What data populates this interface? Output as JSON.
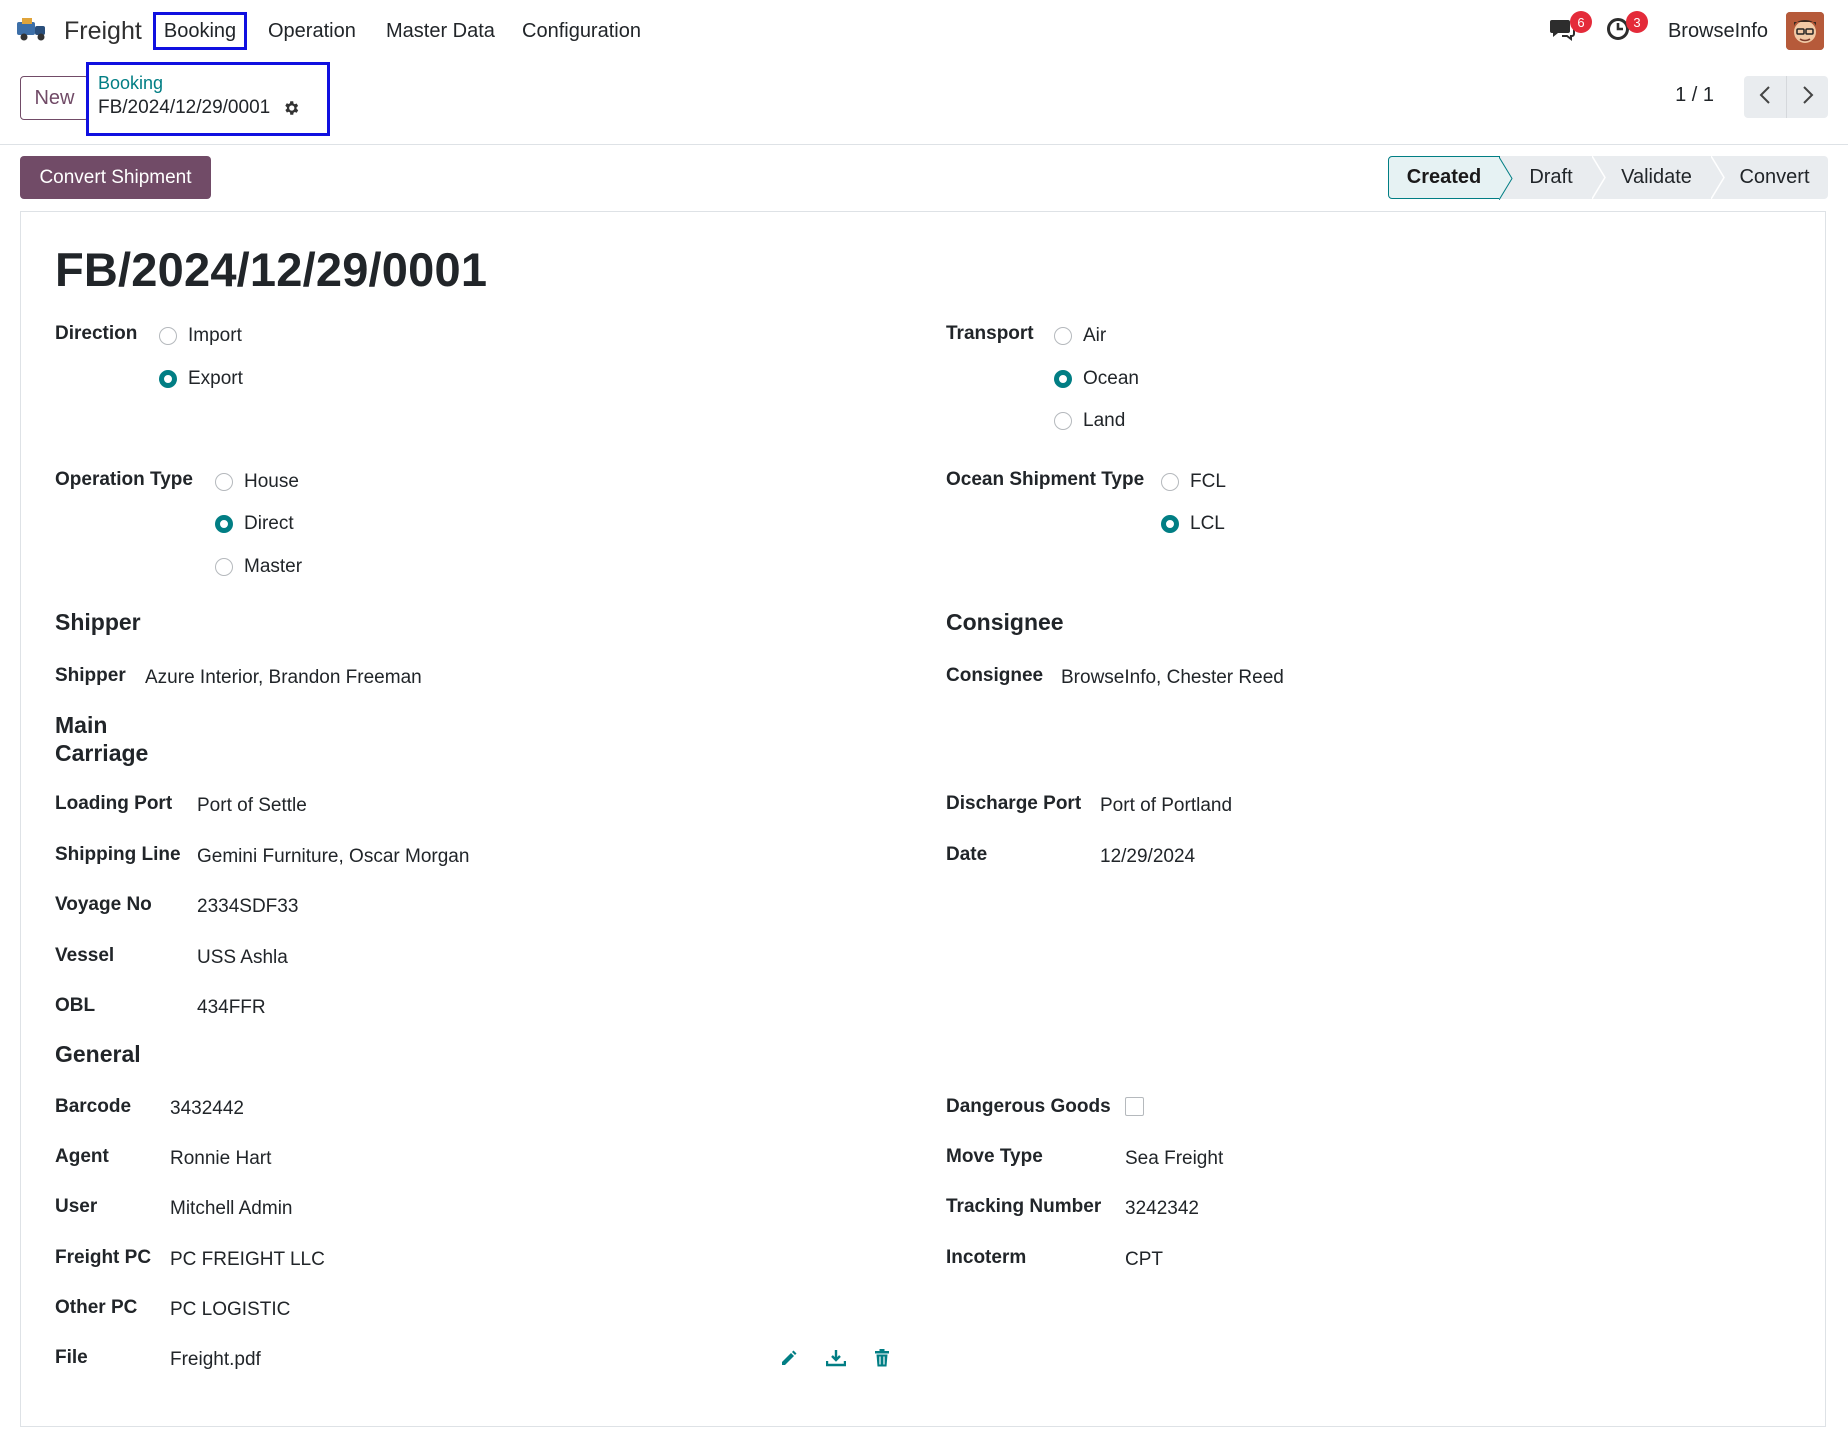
{
  "navbar": {
    "app_name": "Freight",
    "menus": [
      "Booking",
      "Operation",
      "Master Data",
      "Configuration"
    ],
    "messages_count": "6",
    "activities_count": "3",
    "company": "BrowseInfo",
    "icons": {
      "app": "truck-icon",
      "messages": "chat-icon",
      "activities": "clock-icon"
    }
  },
  "control_panel": {
    "new_label": "New",
    "breadcrumb_parent": "Booking",
    "breadcrumb_current": "FB/2024/12/29/0001",
    "pager": "1 / 1"
  },
  "actions": {
    "convert_shipment": "Convert Shipment"
  },
  "statusbar": {
    "stages": [
      "Created",
      "Draft",
      "Validate",
      "Convert"
    ],
    "active": "Created"
  },
  "record": {
    "title": "FB/2024/12/29/0001",
    "direction": {
      "label": "Direction",
      "options": [
        "Import",
        "Export"
      ],
      "selected": "Export"
    },
    "transport": {
      "label": "Transport",
      "options": [
        "Air",
        "Ocean",
        "Land"
      ],
      "selected": "Ocean"
    },
    "operation_type": {
      "label": "Operation Type",
      "options": [
        "House",
        "Direct",
        "Master"
      ],
      "selected": "Direct"
    },
    "ocean_shipment_type": {
      "label": "Ocean Shipment Type",
      "options": [
        "FCL",
        "LCL"
      ],
      "selected": "LCL"
    },
    "shipper_section": "Shipper",
    "consignee_section": "Consignee",
    "shipper": {
      "label": "Shipper",
      "value": "Azure Interior, Brandon Freeman"
    },
    "consignee": {
      "label": "Consignee",
      "value": "BrowseInfo, Chester Reed"
    },
    "main_carriage_section": [
      "Main",
      "Carriage"
    ],
    "loading_port": {
      "label": "Loading Port",
      "value": "Port of Settle"
    },
    "discharge_port": {
      "label": "Discharge Port",
      "value": "Port of Portland"
    },
    "shipping_line": {
      "label": "Shipping Line",
      "value": "Gemini Furniture, Oscar Morgan"
    },
    "date": {
      "label": "Date",
      "value": "12/29/2024"
    },
    "voyage_no": {
      "label": "Voyage No",
      "value": "2334SDF33"
    },
    "vessel": {
      "label": "Vessel",
      "value": "USS Ashla"
    },
    "obl": {
      "label": "OBL",
      "value": "434FFR"
    },
    "general_section": "General",
    "barcode": {
      "label": "Barcode",
      "value": "3432442"
    },
    "dangerous_goods": {
      "label": "Dangerous Goods",
      "checked": false
    },
    "agent": {
      "label": "Agent",
      "value": "Ronnie Hart"
    },
    "move_type": {
      "label": "Move Type",
      "value": "Sea Freight"
    },
    "user": {
      "label": "User",
      "value": "Mitchell Admin"
    },
    "tracking_number": {
      "label": "Tracking Number",
      "value": "3242342"
    },
    "freight_pc": {
      "label": "Freight PC",
      "value": "PC FREIGHT LLC"
    },
    "incoterm": {
      "label": "Incoterm",
      "value": "CPT"
    },
    "other_pc": {
      "label": "Other PC",
      "value": "PC LOGISTIC"
    },
    "file": {
      "label": "File",
      "value": "Freight.pdf"
    }
  },
  "colors": {
    "primary": "#714b67",
    "accent": "#017e84",
    "badge": "#e42b3a",
    "highlight_box": "#1010e0"
  }
}
